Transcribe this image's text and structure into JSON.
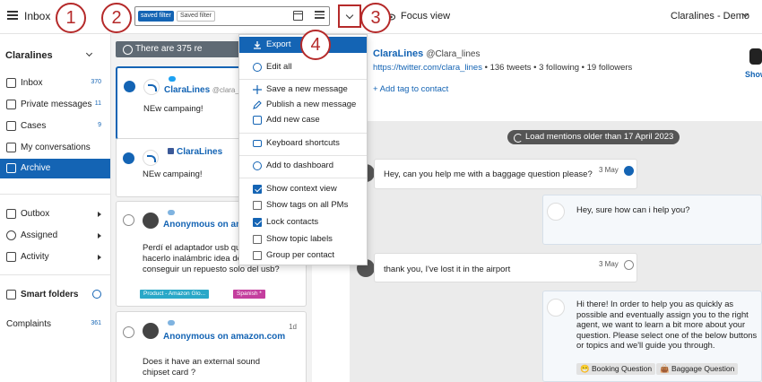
{
  "header": {
    "title": "Inbox",
    "filter_chip_selected": "saved filter",
    "filter_chip": "Saved filter",
    "focus_view": "Focus view",
    "account": "Claralines - Demo"
  },
  "callouts": [
    "1",
    "2",
    "3",
    "4"
  ],
  "sidebar": {
    "title": "Claralines",
    "items": [
      {
        "label": "Inbox",
        "count": "370",
        "icon": "inbox-icon"
      },
      {
        "label": "Private messages",
        "count": "11",
        "icon": "envelope-icon"
      },
      {
        "label": "Cases",
        "count": "9",
        "icon": "briefcase-icon"
      },
      {
        "label": "My conversations",
        "count": "",
        "icon": "chat-icon"
      },
      {
        "label": "Archive",
        "count": "",
        "icon": "archive-icon",
        "active": true
      }
    ],
    "groups": [
      {
        "label": "Outbox",
        "icon": "outbox-icon"
      },
      {
        "label": "Assigned",
        "icon": "check-circle-icon"
      },
      {
        "label": "Activity",
        "icon": "activity-icon"
      }
    ],
    "smart_folders": "Smart folders",
    "complaints": {
      "label": "Complaints",
      "count": "361"
    }
  },
  "list": {
    "banner": "There are 375 re",
    "cards": [
      {
        "name": "ClaraLines",
        "handle": "@clara_lin",
        "text": "NEw campaing!",
        "network": "twitter",
        "checked": true
      },
      {
        "name": "ClaraLines",
        "handle": "",
        "text": "NEw campaing!",
        "network": "facebook",
        "checked": true
      },
      {
        "name": "Anonymous",
        "source": "on ama",
        "text": "Perdí el adaptador usb que pc para hacerlo inalámbric idea de como conseguir un repuesto solo del usb?",
        "network": "web",
        "checked": false,
        "tags": [
          "Product - Amazon Glo...",
          "Spanish *"
        ]
      },
      {
        "name": "Anonymous",
        "source": "on amazon.com",
        "text": "Does it have an external sound chipset card ?",
        "network": "web",
        "checked": false,
        "time": "1d"
      }
    ]
  },
  "menu": {
    "items": [
      {
        "label": "Export",
        "icon": "download-icon",
        "highlighted": true
      },
      {
        "label": "Edit all",
        "icon": "gear-icon"
      },
      {
        "label": "Save a new message",
        "icon": "plus-icon"
      },
      {
        "label": "Publish a new message",
        "icon": "pencil-icon"
      },
      {
        "label": "Add new case",
        "icon": "clipboard-icon"
      },
      {
        "label": "Keyboard shortcuts",
        "icon": "keyboard-icon"
      },
      {
        "label": "Add to dashboard",
        "icon": "plus-circle-icon"
      }
    ],
    "checkboxes": [
      {
        "label": "Show context view",
        "checked": true
      },
      {
        "label": "Show tags on all PMs",
        "checked": false
      },
      {
        "label": "Lock contacts",
        "checked": true
      },
      {
        "label": "Show topic labels",
        "checked": false
      },
      {
        "label": "Group per contact",
        "checked": false
      }
    ]
  },
  "contact": {
    "name": "ClaraLines",
    "handle": "@Clara_lines",
    "url": "https://twitter.com/clara_lines",
    "stats": " • 136 tweets • 3 following • 19 followers",
    "add_tag": "+ Add tag to contact",
    "show": "Show"
  },
  "conversation": {
    "load_older": "Load mentions older than 17 April 2023",
    "messages": [
      {
        "text": "Hey, can you help me with a baggage question please?",
        "date": "3 May",
        "direction": "in"
      },
      {
        "text": "Hey, sure how can i help you?",
        "date": "",
        "direction": "out"
      },
      {
        "text": "thank you, I've lost it in the airport",
        "date": "3 May",
        "direction": "in"
      },
      {
        "text": "Hi there! In order to help you as quickly as possible and eventually assign you to the right agent, we want to learn a bit more about your question. Please select one of the below buttons or topics and we'll guide you through.",
        "date": "",
        "direction": "out"
      }
    ],
    "quick_replies": [
      "😁 Booking Question",
      "👜 Baggage Question"
    ]
  },
  "colors": {
    "accent": "#1464b4",
    "callout": "#b52a2a",
    "sidebar_active": "#1464b4"
  }
}
